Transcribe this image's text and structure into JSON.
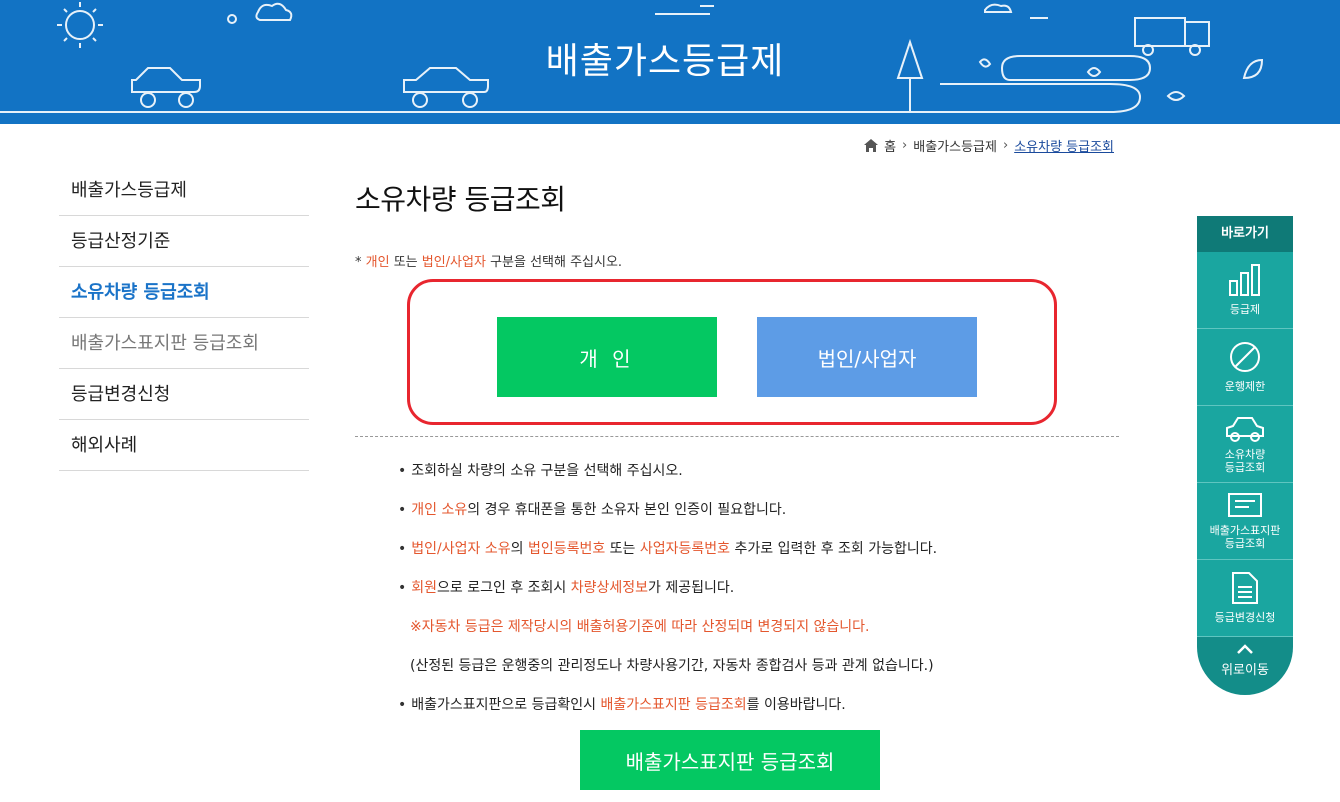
{
  "banner": {
    "title": "배출가스등급제"
  },
  "breadcrumb": {
    "home": "홈",
    "level1": "배출가스등급제",
    "current": "소유차량 등급조회"
  },
  "lnb": [
    "배출가스등급제",
    "등급산정기준",
    "소유차량 등급조회",
    "배출가스표지판 등급조회",
    "등급변경신청",
    "해외사례"
  ],
  "page": {
    "title": "소유차량 등급조회"
  },
  "notice": {
    "prefix": "* ",
    "a": "개인",
    "b": " 또는 ",
    "c": "법인/사업자",
    "d": " 구분을 선택해 주십시오."
  },
  "buttons": {
    "individual": "개 인",
    "corporate": "법인/사업자",
    "sign": "배출가스표지판 등급조회"
  },
  "info": {
    "l1": "조회하실 차량의 소유 구분을 선택해 주십시오.",
    "l2a": "개인 소유",
    "l2b": "의 경우 휴대폰을 통한 소유자 본인 인증이 필요합니다.",
    "l3a": "법인/사업자 소유",
    "l3b": "의 ",
    "l3c": "법인등록번호",
    "l3d": " 또는 ",
    "l3e": "사업자등록번호",
    "l3f": " 추가로 입력한 후 조회 가능합니다.",
    "l4a": "회원",
    "l4b": "으로 로그인 후 조회시 ",
    "l4c": "차량상세정보",
    "l4d": "가 제공됩니다.",
    "l5": "※자동차 등급은 제작당시의 배출허용기준에 따라 산정되며 변경되지 않습니다.",
    "l6": "(산정된 등급은 운행중의 관리정도나 차량사용기간, 자동차 종합검사 등과 관계 없습니다.)",
    "l7a": "배출가스표지판으로 등급확인시 ",
    "l7b": "배출가스표지판 등급조회",
    "l7c": "를 이용바랍니다."
  },
  "quick": {
    "title": "바로가기",
    "items": [
      "등급제",
      "운행제한",
      "소유차량\n등급조회",
      "배출가스표지판\n등급조회",
      "등급변경신청"
    ],
    "top": "위로이동"
  },
  "colors": {
    "banner": "#1273c4",
    "green": "#04c862",
    "blue": "#5d9ce6",
    "red": "#e8262f",
    "accent": "#e4572e",
    "teal": "#1aa6a0"
  }
}
